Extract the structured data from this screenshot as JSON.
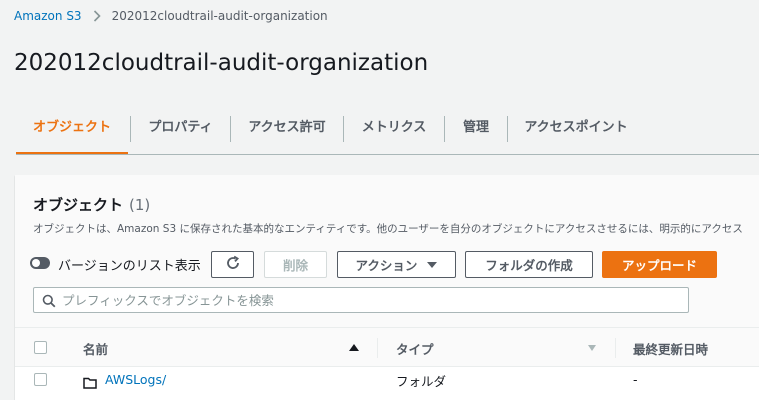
{
  "breadcrumb": {
    "root": "Amazon S3",
    "current": "202012cloudtrail-audit-organization"
  },
  "page_title": "202012cloudtrail-audit-organization",
  "tabs": [
    {
      "label": "オブジェクト",
      "active": true
    },
    {
      "label": "プロパティ"
    },
    {
      "label": "アクセス許可"
    },
    {
      "label": "メトリクス"
    },
    {
      "label": "管理"
    },
    {
      "label": "アクセスポイント"
    }
  ],
  "objects_panel": {
    "title": "オブジェクト",
    "count": "(1)",
    "description": "オブジェクトは、Amazon S3 に保存された基本的なエンティティです。他のユーザーを自分のオブジェクトにアクセスさせるには、明示的にアクセス",
    "version_toggle_label": "バージョンのリスト表示",
    "buttons": {
      "delete": "削除",
      "actions": "アクション",
      "create_folder": "フォルダの作成",
      "upload": "アップロード"
    },
    "search_placeholder": "プレフィックスでオブジェクトを検索"
  },
  "table": {
    "columns": {
      "name": "名前",
      "type": "タイプ",
      "last_modified": "最終更新日時"
    },
    "rows": [
      {
        "name": "AWSLogs/",
        "type": "フォルダ",
        "last_modified": "-"
      }
    ]
  },
  "colors": {
    "accent": "#ec7211",
    "link": "#0073bb",
    "text": "#16191f",
    "muted": "#545b64"
  },
  "icons": [
    "chevron-right-icon",
    "refresh-icon",
    "caret-down-icon",
    "search-icon",
    "sort-up-icon",
    "sort-down-icon",
    "folder-icon"
  ]
}
